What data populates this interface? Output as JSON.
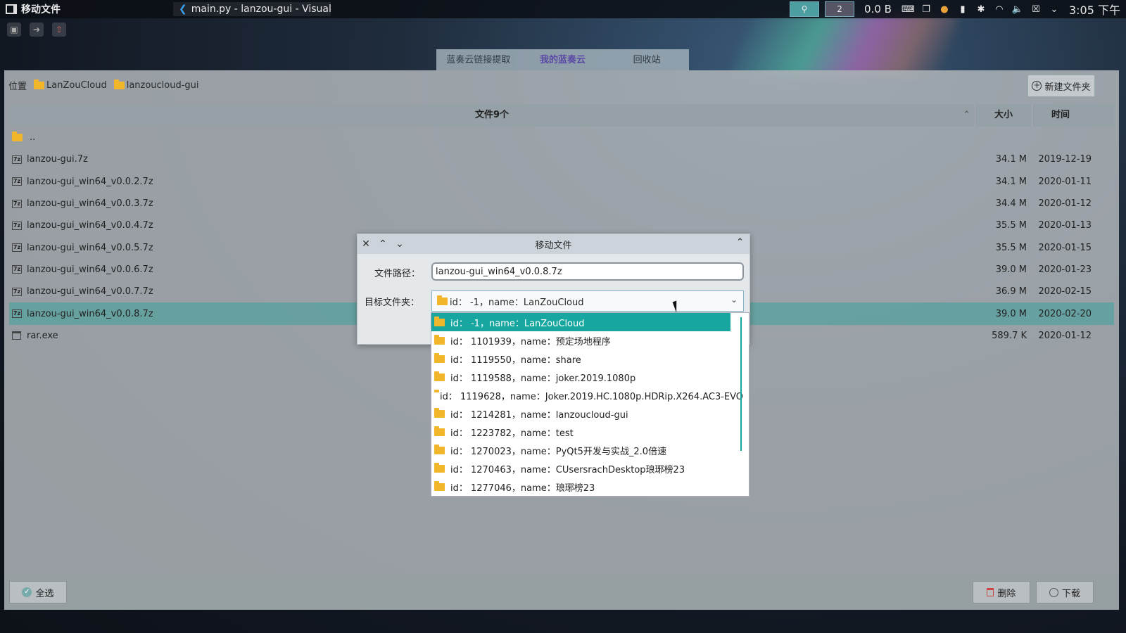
{
  "taskbar": {
    "active_app": "移动文件",
    "task_title": "main.py - lanzou-gui - Visual St···",
    "workspace_1": "",
    "workspace_2": "2",
    "net_speed": "0.0 B",
    "clock": "3:05 下午"
  },
  "tabs": [
    "蓝奏云链接提取",
    "我的蓝奏云",
    "回收站"
  ],
  "active_tab": "我的蓝奏云",
  "breadcrumb": {
    "label": "位置",
    "items": [
      "LanZouCloud",
      "lanzoucloud-gui"
    ]
  },
  "new_folder_label": "新建文件夹",
  "table": {
    "header_name": "文件9个",
    "header_size": "大小",
    "header_time": "时间",
    "rows": [
      {
        "name": "..",
        "size": "",
        "time": "",
        "type": "folder"
      },
      {
        "name": "lanzou-gui.7z",
        "size": "34.1 M",
        "time": "2019-12-19",
        "type": "7z"
      },
      {
        "name": "lanzou-gui_win64_v0.0.2.7z",
        "size": "34.1 M",
        "time": "2020-01-11",
        "type": "7z"
      },
      {
        "name": "lanzou-gui_win64_v0.0.3.7z",
        "size": "34.4 M",
        "time": "2020-01-12",
        "type": "7z"
      },
      {
        "name": "lanzou-gui_win64_v0.0.4.7z",
        "size": "35.5 M",
        "time": "2020-01-13",
        "type": "7z"
      },
      {
        "name": "lanzou-gui_win64_v0.0.5.7z",
        "size": "35.5 M",
        "time": "2020-01-15",
        "type": "7z"
      },
      {
        "name": "lanzou-gui_win64_v0.0.6.7z",
        "size": "39.0 M",
        "time": "2020-01-23",
        "type": "7z"
      },
      {
        "name": "lanzou-gui_win64_v0.0.7.7z",
        "size": "36.9 M",
        "time": "2020-02-15",
        "type": "7z"
      },
      {
        "name": "lanzou-gui_win64_v0.0.8.7z",
        "size": "39.0 M",
        "time": "2020-02-20",
        "type": "7z"
      },
      {
        "name": "rar.exe",
        "size": "589.7 K",
        "time": "2020-01-12",
        "type": "exe"
      }
    ]
  },
  "bottom": {
    "select_all": "全选",
    "delete": "删除",
    "download": "下载"
  },
  "dialog": {
    "title": "移动文件",
    "path_label": "文件路径：",
    "path_value": "lanzou-gui_win64_v0.0.8.7z",
    "target_label": "目标文件夹：",
    "target_value": "id：    -1，name：LanZouCloud",
    "options": [
      "id：    -1，name：LanZouCloud",
      "id：  1101939，name：预定场地程序",
      "id：  1119550，name：share",
      "id：  1119588，name：joker.2019.1080p",
      "id：  1119628，name：Joker.2019.HC.1080p.HDRip.X264.AC3-EVO",
      "id：  1214281，name：lanzoucloud-gui",
      "id：  1223782，name：test",
      "id：  1270023，name：PyQt5开发与实战_2.0倍速",
      "id：  1270463，name：CUsersrachDesktop琅琊榜23",
      "id：  1277046，name：琅琊榜23"
    ]
  },
  "colors": {
    "accent": "#17a6a0",
    "selection_row": "#56a09e",
    "folder": "#f2b62a",
    "active_tab": "#5a4aa5"
  }
}
